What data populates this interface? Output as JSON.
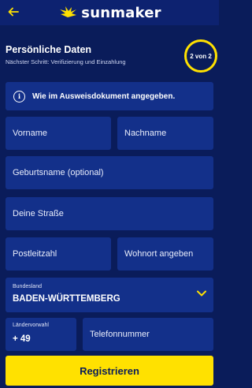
{
  "header": {
    "logo_text": "sunmaker",
    "back_icon": "arrow-left-icon"
  },
  "form_header": {
    "title": "Persönliche Daten",
    "subtitle": "Nächster Schritt: Verifizierung und Einzahlung",
    "step": "2 von 2"
  },
  "info": {
    "icon": "info-icon",
    "text": "Wie im Ausweisdokument angegeben."
  },
  "fields": {
    "first_name": "Vorname",
    "last_name": "Nachname",
    "birth_name": "Geburtsname (optional)",
    "street": "Deine Straße",
    "postal_code": "Postleitzahl",
    "city": "Wohnort angeben",
    "state_label": "Bundesland",
    "state_value": "BADEN-WÜRTTEMBERG",
    "prefix_label": "Ländervorwahl",
    "prefix_value": "+ 49",
    "phone": "Telefonnummer"
  },
  "submit_label": "Registrieren",
  "colors": {
    "background": "#0a1c5a",
    "field": "#13308a",
    "accent": "#ffe100"
  }
}
